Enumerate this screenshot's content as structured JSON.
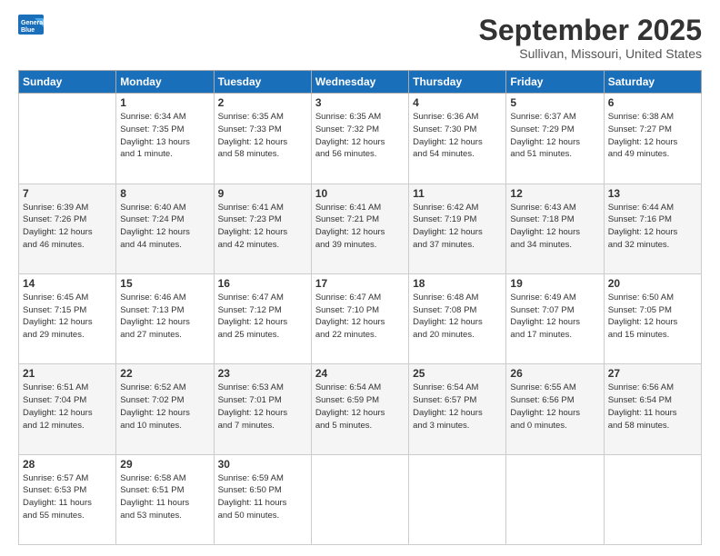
{
  "header": {
    "logo_line1": "General",
    "logo_line2": "Blue",
    "month": "September 2025",
    "location": "Sullivan, Missouri, United States"
  },
  "weekdays": [
    "Sunday",
    "Monday",
    "Tuesday",
    "Wednesday",
    "Thursday",
    "Friday",
    "Saturday"
  ],
  "weeks": [
    [
      {
        "day": "",
        "info": ""
      },
      {
        "day": "1",
        "info": "Sunrise: 6:34 AM\nSunset: 7:35 PM\nDaylight: 13 hours\nand 1 minute."
      },
      {
        "day": "2",
        "info": "Sunrise: 6:35 AM\nSunset: 7:33 PM\nDaylight: 12 hours\nand 58 minutes."
      },
      {
        "day": "3",
        "info": "Sunrise: 6:35 AM\nSunset: 7:32 PM\nDaylight: 12 hours\nand 56 minutes."
      },
      {
        "day": "4",
        "info": "Sunrise: 6:36 AM\nSunset: 7:30 PM\nDaylight: 12 hours\nand 54 minutes."
      },
      {
        "day": "5",
        "info": "Sunrise: 6:37 AM\nSunset: 7:29 PM\nDaylight: 12 hours\nand 51 minutes."
      },
      {
        "day": "6",
        "info": "Sunrise: 6:38 AM\nSunset: 7:27 PM\nDaylight: 12 hours\nand 49 minutes."
      }
    ],
    [
      {
        "day": "7",
        "info": "Sunrise: 6:39 AM\nSunset: 7:26 PM\nDaylight: 12 hours\nand 46 minutes."
      },
      {
        "day": "8",
        "info": "Sunrise: 6:40 AM\nSunset: 7:24 PM\nDaylight: 12 hours\nand 44 minutes."
      },
      {
        "day": "9",
        "info": "Sunrise: 6:41 AM\nSunset: 7:23 PM\nDaylight: 12 hours\nand 42 minutes."
      },
      {
        "day": "10",
        "info": "Sunrise: 6:41 AM\nSunset: 7:21 PM\nDaylight: 12 hours\nand 39 minutes."
      },
      {
        "day": "11",
        "info": "Sunrise: 6:42 AM\nSunset: 7:19 PM\nDaylight: 12 hours\nand 37 minutes."
      },
      {
        "day": "12",
        "info": "Sunrise: 6:43 AM\nSunset: 7:18 PM\nDaylight: 12 hours\nand 34 minutes."
      },
      {
        "day": "13",
        "info": "Sunrise: 6:44 AM\nSunset: 7:16 PM\nDaylight: 12 hours\nand 32 minutes."
      }
    ],
    [
      {
        "day": "14",
        "info": "Sunrise: 6:45 AM\nSunset: 7:15 PM\nDaylight: 12 hours\nand 29 minutes."
      },
      {
        "day": "15",
        "info": "Sunrise: 6:46 AM\nSunset: 7:13 PM\nDaylight: 12 hours\nand 27 minutes."
      },
      {
        "day": "16",
        "info": "Sunrise: 6:47 AM\nSunset: 7:12 PM\nDaylight: 12 hours\nand 25 minutes."
      },
      {
        "day": "17",
        "info": "Sunrise: 6:47 AM\nSunset: 7:10 PM\nDaylight: 12 hours\nand 22 minutes."
      },
      {
        "day": "18",
        "info": "Sunrise: 6:48 AM\nSunset: 7:08 PM\nDaylight: 12 hours\nand 20 minutes."
      },
      {
        "day": "19",
        "info": "Sunrise: 6:49 AM\nSunset: 7:07 PM\nDaylight: 12 hours\nand 17 minutes."
      },
      {
        "day": "20",
        "info": "Sunrise: 6:50 AM\nSunset: 7:05 PM\nDaylight: 12 hours\nand 15 minutes."
      }
    ],
    [
      {
        "day": "21",
        "info": "Sunrise: 6:51 AM\nSunset: 7:04 PM\nDaylight: 12 hours\nand 12 minutes."
      },
      {
        "day": "22",
        "info": "Sunrise: 6:52 AM\nSunset: 7:02 PM\nDaylight: 12 hours\nand 10 minutes."
      },
      {
        "day": "23",
        "info": "Sunrise: 6:53 AM\nSunset: 7:01 PM\nDaylight: 12 hours\nand 7 minutes."
      },
      {
        "day": "24",
        "info": "Sunrise: 6:54 AM\nSunset: 6:59 PM\nDaylight: 12 hours\nand 5 minutes."
      },
      {
        "day": "25",
        "info": "Sunrise: 6:54 AM\nSunset: 6:57 PM\nDaylight: 12 hours\nand 3 minutes."
      },
      {
        "day": "26",
        "info": "Sunrise: 6:55 AM\nSunset: 6:56 PM\nDaylight: 12 hours\nand 0 minutes."
      },
      {
        "day": "27",
        "info": "Sunrise: 6:56 AM\nSunset: 6:54 PM\nDaylight: 11 hours\nand 58 minutes."
      }
    ],
    [
      {
        "day": "28",
        "info": "Sunrise: 6:57 AM\nSunset: 6:53 PM\nDaylight: 11 hours\nand 55 minutes."
      },
      {
        "day": "29",
        "info": "Sunrise: 6:58 AM\nSunset: 6:51 PM\nDaylight: 11 hours\nand 53 minutes."
      },
      {
        "day": "30",
        "info": "Sunrise: 6:59 AM\nSunset: 6:50 PM\nDaylight: 11 hours\nand 50 minutes."
      },
      {
        "day": "",
        "info": ""
      },
      {
        "day": "",
        "info": ""
      },
      {
        "day": "",
        "info": ""
      },
      {
        "day": "",
        "info": ""
      }
    ]
  ]
}
